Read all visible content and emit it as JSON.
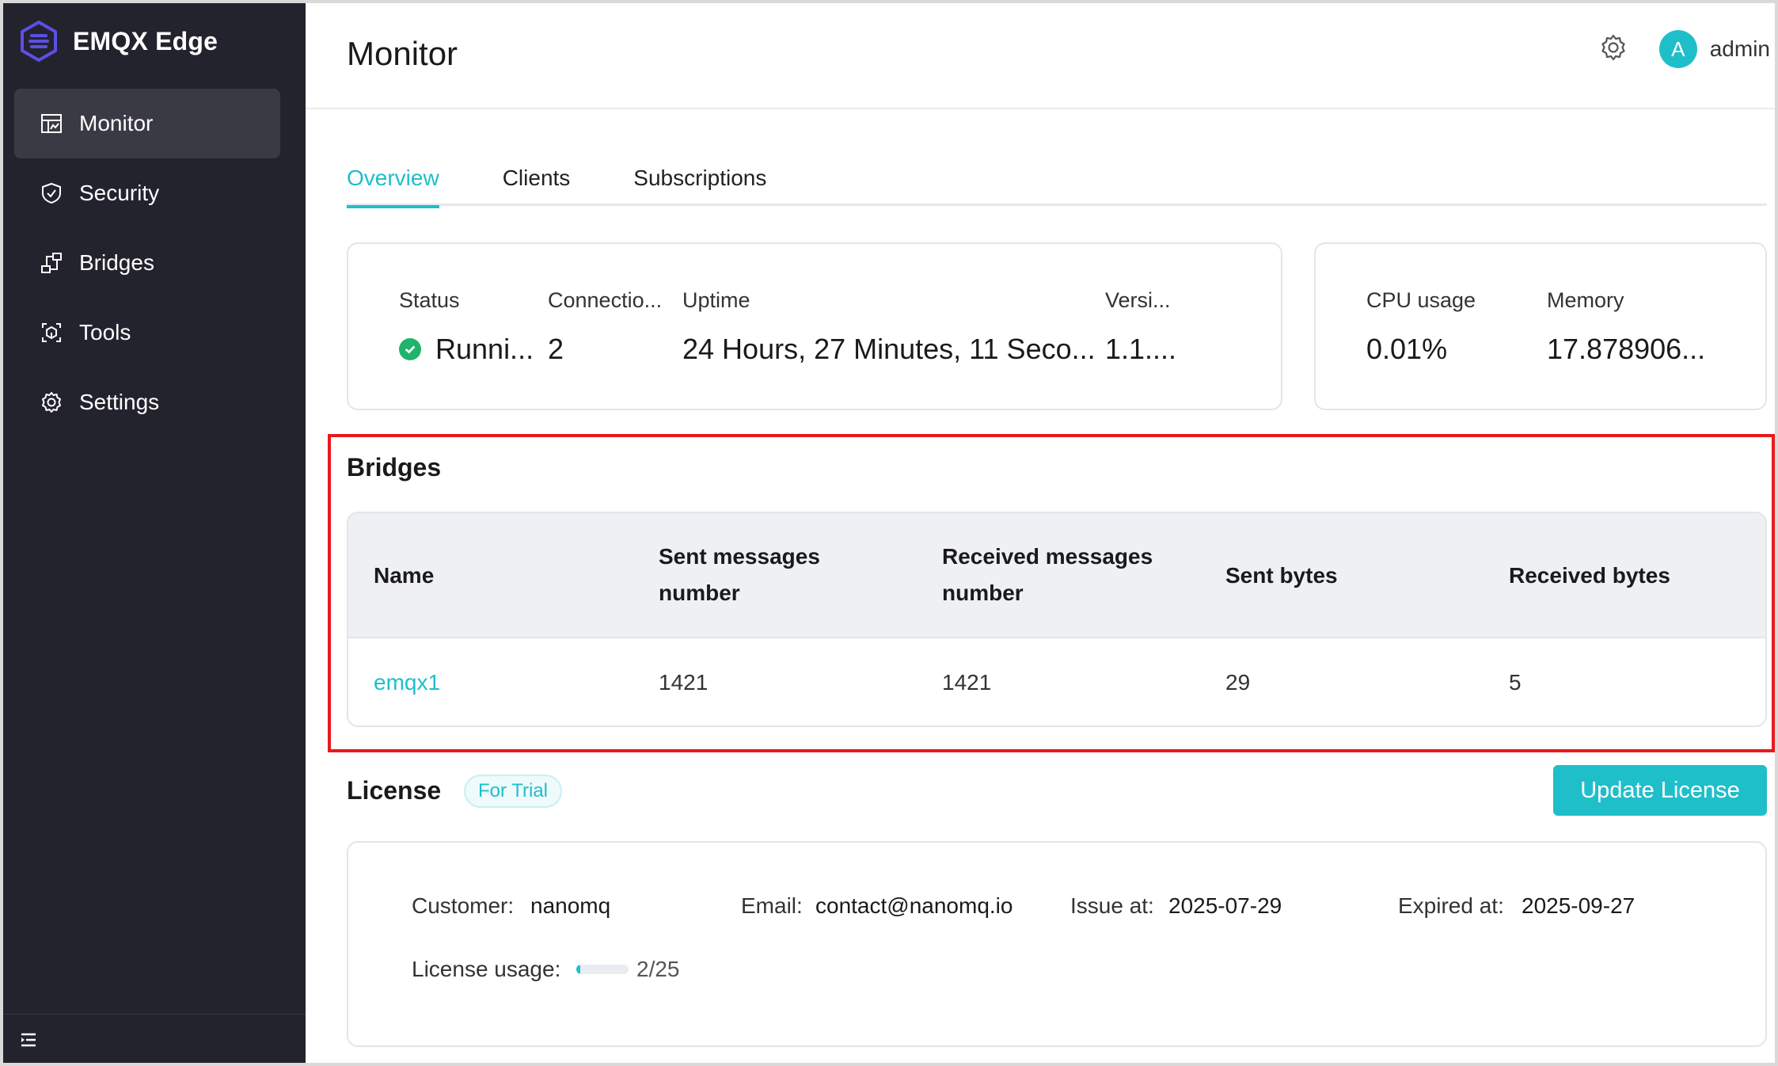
{
  "app": {
    "brand": "EMQX Edge"
  },
  "sidebar": {
    "items": [
      {
        "label": "Monitor",
        "icon": "dashboard-icon",
        "active": true
      },
      {
        "label": "Security",
        "icon": "shield-check-icon",
        "active": false
      },
      {
        "label": "Bridges",
        "icon": "bridge-icon",
        "active": false
      },
      {
        "label": "Tools",
        "icon": "tools-icon",
        "active": false
      },
      {
        "label": "Settings",
        "icon": "gear-icon",
        "active": false
      }
    ],
    "collapse_icon": "collapse-menu-icon"
  },
  "header": {
    "title": "Monitor",
    "user": {
      "initial": "A",
      "name": "admin"
    }
  },
  "tabs": [
    {
      "label": "Overview",
      "active": true
    },
    {
      "label": "Clients",
      "active": false
    },
    {
      "label": "Subscriptions",
      "active": false
    }
  ],
  "overview": {
    "status_label": "Status",
    "status_value": "Runni...",
    "connections_label": "Connectio...",
    "connections_value": "2",
    "uptime_label": "Uptime",
    "uptime_value": "24 Hours, 27 Minutes, 11 Seco...",
    "version_label": "Versi...",
    "version_value": "1.1....",
    "cpu_label": "CPU usage",
    "cpu_value": "0.01%",
    "memory_label": "Memory",
    "memory_value": "17.878906..."
  },
  "bridges": {
    "title": "Bridges",
    "columns": [
      "Name",
      "Sent messages number",
      "Received messages number",
      "Sent bytes",
      "Received bytes"
    ],
    "rows": [
      {
        "name": "emqx1",
        "sent_messages": "1421",
        "received_messages": "1421",
        "sent_bytes": "29",
        "received_bytes": "5"
      }
    ]
  },
  "license": {
    "title": "License",
    "badge": "For Trial",
    "update_button": "Update License",
    "customer_label": "Customer:",
    "customer_value": "nanomq",
    "email_label": "Email:",
    "email_value": "contact@nanomq.io",
    "issue_label": "Issue at:",
    "issue_value": "2025-07-29",
    "expired_label": "Expired at:",
    "expired_value": "2025-09-27",
    "usage_label": "License usage:",
    "usage_value": "2/25",
    "usage_fraction": 0.08
  },
  "colors": {
    "accent": "#1fbfca",
    "sidebar_bg": "#23232e",
    "highlight": "#e8191d",
    "status_ok": "#1fb36b"
  }
}
